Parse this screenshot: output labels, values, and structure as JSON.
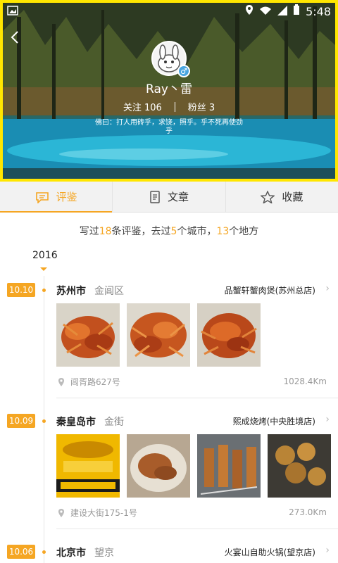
{
  "status": {
    "time": "5:48"
  },
  "profile": {
    "username": "Ray丶雷",
    "following": "关注 106",
    "fans": "粉丝 3",
    "bio": "佛曰：打人用砖乎，求饶，照乎。乎不死再使劲乎"
  },
  "tabs": [
    {
      "label": "评鉴",
      "icon": "comment-icon",
      "active": true
    },
    {
      "label": "文章",
      "icon": "article-icon",
      "active": false
    },
    {
      "label": "收藏",
      "icon": "star-icon",
      "active": false
    }
  ],
  "summary": {
    "prefix": "写过",
    "reviews": "18",
    "mid1": "条评鉴，去过",
    "cities": "5",
    "mid2": "个城市，",
    "places": "13",
    "suffix": "个地方"
  },
  "year": "2016",
  "entries": [
    {
      "date": "10.10",
      "city": "苏州市",
      "district": "金阊区",
      "shop": "品蟹轩蟹肉煲(苏州总店)",
      "address": "阊胥路627号",
      "distance": "1028.4Km"
    },
    {
      "date": "10.09",
      "city": "秦皇岛市",
      "district": "金街",
      "shop": "熙成烧烤(中央胜境店)",
      "address": "建设大街175-1号",
      "distance": "273.0Km"
    },
    {
      "date": "10.06",
      "city": "北京市",
      "district": "望京",
      "shop": "火宴山自助火锅(望京店)"
    }
  ],
  "colors": {
    "accent": "#f5a623",
    "header_border": "#ffe600"
  }
}
